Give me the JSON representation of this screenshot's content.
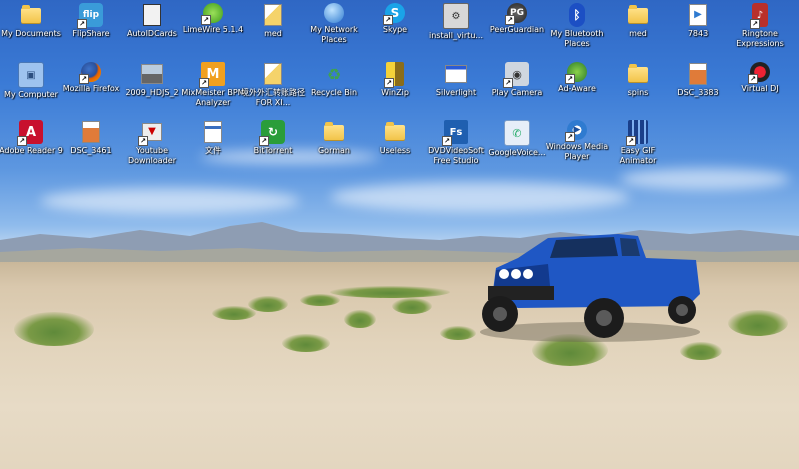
{
  "desktop": {
    "icons": [
      {
        "label": "My Documents",
        "icon": "my-documents-icon"
      },
      {
        "label": "FlipShare",
        "icon": "flipshare-icon"
      },
      {
        "label": "AutoIDCards",
        "icon": "document-icon"
      },
      {
        "label": "LimeWire 5.1.4",
        "icon": "limewire-icon"
      },
      {
        "label": "med",
        "icon": "image-file-icon"
      },
      {
        "label": "My Network Places",
        "icon": "network-places-icon"
      },
      {
        "label": "Skype",
        "icon": "skype-icon"
      },
      {
        "label": "install_virtu...",
        "icon": "installer-icon"
      },
      {
        "label": "PeerGuardian",
        "icon": "peerguardian-icon"
      },
      {
        "label": "My Bluetooth Places",
        "icon": "bluetooth-icon"
      },
      {
        "label": "med",
        "icon": "folder-icon"
      },
      {
        "label": "7843",
        "icon": "media-file-icon"
      },
      {
        "label": "Ringtone Expressions",
        "icon": "ringtone-icon"
      },
      {
        "label": "My Computer",
        "icon": "my-computer-icon"
      },
      {
        "label": "Mozilla Firefox",
        "icon": "firefox-icon"
      },
      {
        "label": "2009_HDJS_2",
        "icon": "image-file-icon"
      },
      {
        "label": "MixMeister BPM Analyzer",
        "icon": "mixmeister-icon"
      },
      {
        "label": "境外外汇转账路径FOR XI...",
        "icon": "image-file-icon"
      },
      {
        "label": "Recycle Bin",
        "icon": "recycle-bin-icon"
      },
      {
        "label": "WinZip",
        "icon": "winzip-icon"
      },
      {
        "label": "Silverlight",
        "icon": "window-icon"
      },
      {
        "label": "Play Camera",
        "icon": "camera-icon"
      },
      {
        "label": "Ad-Aware",
        "icon": "ad-aware-icon"
      },
      {
        "label": "spins",
        "icon": "folder-icon"
      },
      {
        "label": "DSC_3383",
        "icon": "image-file-icon"
      },
      {
        "label": "Virtual DJ",
        "icon": "virtual-dj-icon"
      },
      {
        "label": "Adobe Reader 9",
        "icon": "adobe-reader-icon"
      },
      {
        "label": "DSC_3461",
        "icon": "image-file-icon"
      },
      {
        "label": "Youtube Downloader",
        "icon": "youtube-downloader-icon"
      },
      {
        "label": "文件",
        "icon": "document-icon"
      },
      {
        "label": "BitTorrent",
        "icon": "bittorrent-icon"
      },
      {
        "label": "Gorman",
        "icon": "folder-icon"
      },
      {
        "label": "Useless",
        "icon": "folder-icon"
      },
      {
        "label": "DVDVideoSoft Free Studio",
        "icon": "dvdvideosoft-icon"
      },
      {
        "label": "GoogleVoice...",
        "icon": "google-voice-icon"
      },
      {
        "label": "Windows Media Player",
        "icon": "media-player-icon"
      },
      {
        "label": "Easy GIF Animator",
        "icon": "gif-animator-icon"
      }
    ]
  }
}
